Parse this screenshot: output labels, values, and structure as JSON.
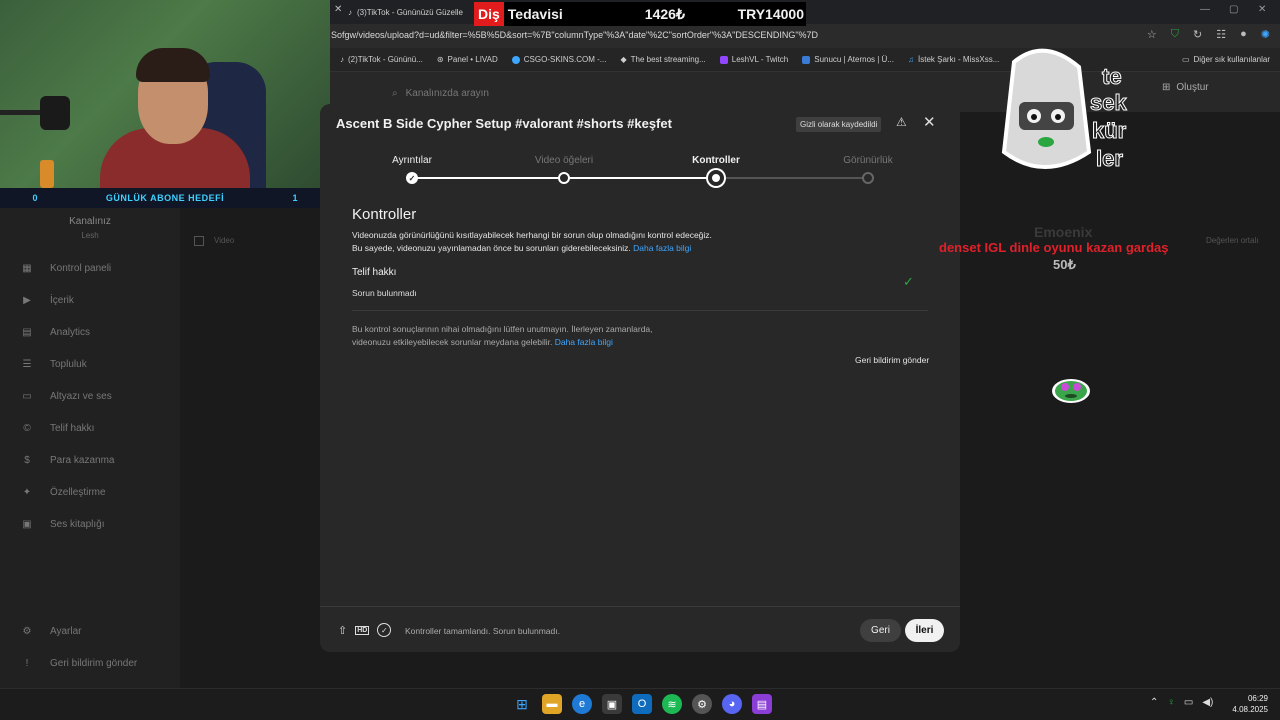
{
  "browser": {
    "tab_title": "(3)TikTok - Gününüzü Güzelle",
    "url": "Sofgw/videos/upload?d=ud&filter=%5B%5D&sort=%7B\"columnType\"%3A\"date\"%2C\"sortOrder\"%3A\"DESCENDING\"%7D",
    "bookmarks": [
      "(2)TikTok - Gününü...",
      "Panel • LIVAD",
      "CSGO-SKINS.COM -...",
      "The best streaming...",
      "LeshVL - Twitch",
      "Sunucu | Aternos | Ü...",
      "İstek Şarkı - MissXss..."
    ],
    "bookmarks_other": "Diğer sık kullanılanlar"
  },
  "banner": {
    "label_red": "Diş",
    "label": "Tedavisi",
    "raised": "1426₺",
    "goal": "TRY14000"
  },
  "stream": {
    "sub_left": "0",
    "sub_title": "GÜNLÜK ABONE HEDEFİ",
    "sub_right": "1"
  },
  "studio": {
    "search_placeholder": "Kanalınızda arayın",
    "create_label": "Oluştur",
    "channel_name": "Kanalınız",
    "channel_handle": "Lesh",
    "nav": [
      {
        "label": "Kontrol paneli",
        "icon": "▦"
      },
      {
        "label": "İçerik",
        "icon": "▶"
      },
      {
        "label": "Analytics",
        "icon": "▤"
      },
      {
        "label": "Topluluk",
        "icon": "☰"
      },
      {
        "label": "Altyazı ve ses",
        "icon": "▭"
      },
      {
        "label": "Telif hakkı",
        "icon": "©"
      },
      {
        "label": "Para kazanma",
        "icon": "$"
      },
      {
        "label": "Özelleştirme",
        "icon": "✦"
      },
      {
        "label": "Ses kitaplığı",
        "icon": "▣"
      }
    ],
    "settings_label": "Ayarlar",
    "feedback_label": "Geri bildirim gönder",
    "video_col": "Video",
    "right_col": "Değerlen ortalı"
  },
  "dialog": {
    "title": "Ascent B Side Cypher Setup #valorant #shorts #keşfet",
    "saved_badge": "Gizli olarak kaydedildi",
    "steps": [
      "Ayrıntılar",
      "Video öğeleri",
      "Kontroller",
      "Görünürlük"
    ],
    "heading": "Kontroller",
    "desc_line1": "Videonuzda görünürlüğünü kısıtlayabilecek herhangi bir sorun olup olmadığını kontrol edeceğiz.",
    "desc_line2": "Bu sayede, videonuzu yayınlamadan önce bu sorunları giderebileceksiniz.",
    "learn_more": "Daha fazla bilgi",
    "copyright_title": "Telif hakkı",
    "copyright_status": "Sorun bulunmadı",
    "note_line1": "Bu kontrol sonuçlarının nihai olmadığını lütfen unutmayın. İlerleyen zamanlarda,",
    "note_line2": "videonuzu etkileyebilecek sorunlar meydana gelebilir.",
    "note_link": "Daha fazla bilgi",
    "feedback": "Geri bildirim gönder",
    "footer_status": "Kontroller tamamlandı. Sorun bulunmadı.",
    "back_label": "Geri",
    "next_label": "İleri"
  },
  "overlay": {
    "sticker_words": [
      "te",
      "sek",
      "kür",
      "ler"
    ],
    "donor_name": "Emoenix",
    "donor_message": "denset IGL dinle oyunu kazan gardaş",
    "donor_amount": "50₺"
  },
  "taskbar": {
    "time": "06:29",
    "date": "4.08.2025"
  },
  "colors": {
    "accent_link": "#3ea6ff",
    "success": "#2ba640",
    "banner_red": "#e21c1c",
    "dialog_bg": "#282828"
  }
}
